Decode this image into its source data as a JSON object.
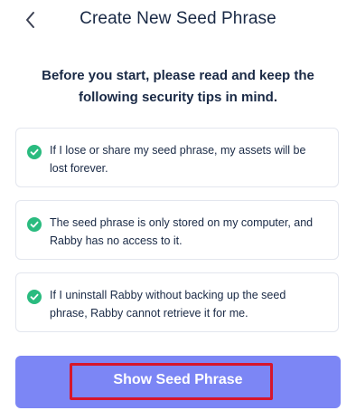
{
  "header": {
    "back_icon": "chevron-left-icon",
    "title": "Create New Seed Phrase"
  },
  "intro": {
    "text": "Before you start, please read and keep the following security tips in mind."
  },
  "tips": [
    {
      "icon": "check-circle-icon",
      "text": "If I lose or share my seed phrase, my assets will be lost forever."
    },
    {
      "icon": "check-circle-icon",
      "text": "The seed phrase is only stored on my computer, and Rabby has no access to it."
    },
    {
      "icon": "check-circle-icon",
      "text": "If I uninstall Rabby without backing up the seed phrase, Rabby cannot retrieve it for me."
    }
  ],
  "action": {
    "label": "Show Seed Phrase",
    "button_color": "#7c86f5",
    "highlight_color": "#d6162c"
  },
  "colors": {
    "text": "#192945",
    "check": "#2abb7f",
    "card_border": "#e3e6ee"
  }
}
